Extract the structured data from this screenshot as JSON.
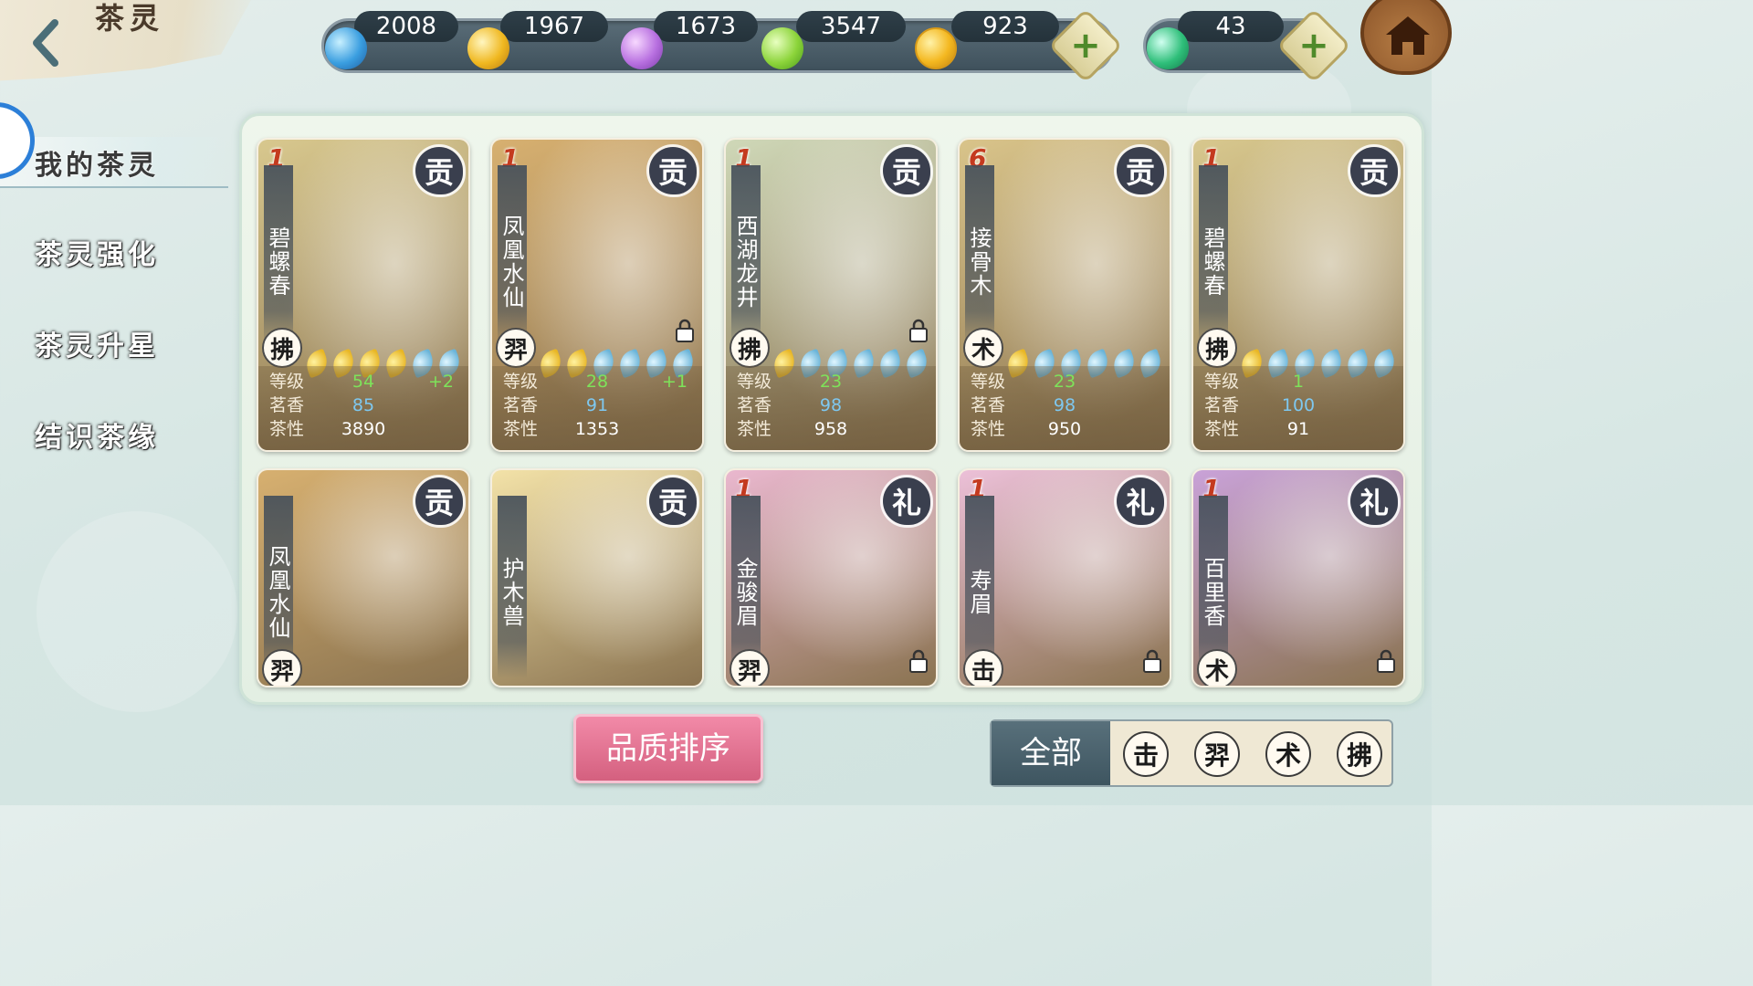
{
  "header": {
    "title": "茶灵",
    "back_icon": "chevron-left-icon",
    "home_icon": "house-icon"
  },
  "currencies": [
    {
      "id": "blue-crystal",
      "value": "2008",
      "color": "#3a9ee0"
    },
    {
      "id": "gold-crystal",
      "value": "1967",
      "color": "#f0b820"
    },
    {
      "id": "purple-crystal",
      "value": "1673",
      "color": "#b870e0"
    },
    {
      "id": "green-crystal",
      "value": "3547",
      "color": "#8cd43a"
    },
    {
      "id": "coin",
      "value": "923",
      "color": "#f4b820"
    },
    {
      "id": "jade",
      "value": "43",
      "color": "#2fbf7a"
    }
  ],
  "menu": {
    "items": [
      {
        "label": "我的茶灵",
        "active": true
      },
      {
        "label": "茶灵强化",
        "active": false
      },
      {
        "label": "茶灵升星",
        "active": false
      },
      {
        "label": "结识茶缘",
        "active": false
      }
    ]
  },
  "stat_labels": {
    "level": "等级",
    "aroma": "茗香",
    "nature": "茶性"
  },
  "cards": [
    {
      "name": "碧螺春",
      "stars": "1",
      "rank": "贡",
      "type": "拂",
      "locked": false,
      "gold_leaves": 4,
      "blue_leaves": 2,
      "level": "54",
      "level_bonus": "+2",
      "aroma": "85",
      "nature": "3890",
      "bg": "#d8c88e"
    },
    {
      "name": "凤凰水仙",
      "stars": "1",
      "rank": "贡",
      "type": "羿",
      "locked": true,
      "gold_leaves": 2,
      "blue_leaves": 4,
      "level": "28",
      "level_bonus": "+1",
      "aroma": "91",
      "nature": "1353",
      "bg": "#d7b070"
    },
    {
      "name": "西湖龙井",
      "stars": "1",
      "rank": "贡",
      "type": "拂",
      "locked": true,
      "gold_leaves": 1,
      "blue_leaves": 5,
      "level": "23",
      "level_bonus": "",
      "aroma": "98",
      "nature": "958",
      "bg": "#cfd8b8"
    },
    {
      "name": "接骨木",
      "stars": "6",
      "rank": "贡",
      "type": "术",
      "locked": false,
      "gold_leaves": 1,
      "blue_leaves": 5,
      "level": "23",
      "level_bonus": "",
      "aroma": "98",
      "nature": "950",
      "bg": "#d9c48a"
    },
    {
      "name": "碧螺春",
      "stars": "1",
      "rank": "贡",
      "type": "拂",
      "locked": false,
      "gold_leaves": 1,
      "blue_leaves": 5,
      "level": "1",
      "level_bonus": "",
      "aroma": "100",
      "nature": "91",
      "bg": "#d8c88e"
    },
    {
      "name": "凤凰水仙",
      "stars": "",
      "rank": "贡",
      "type": "羿",
      "locked": false,
      "bg": "#d7b070"
    },
    {
      "name": "护木兽",
      "stars": "",
      "rank": "贡",
      "type": "",
      "locked": false,
      "bg": "#f3e2a8"
    },
    {
      "name": "金骏眉",
      "stars": "1",
      "rank": "礼",
      "type": "羿",
      "locked": true,
      "bg": "#eab8cf"
    },
    {
      "name": "寿眉",
      "stars": "1",
      "rank": "礼",
      "type": "击",
      "locked": true,
      "bg": "#ecc0d8"
    },
    {
      "name": "百里香",
      "stars": "1",
      "rank": "礼",
      "type": "术",
      "locked": true,
      "bg": "#c9a2d8"
    }
  ],
  "sort_button": "品质排序",
  "filter": {
    "all_label": "全部",
    "types": [
      "击",
      "羿",
      "术",
      "拂"
    ]
  }
}
